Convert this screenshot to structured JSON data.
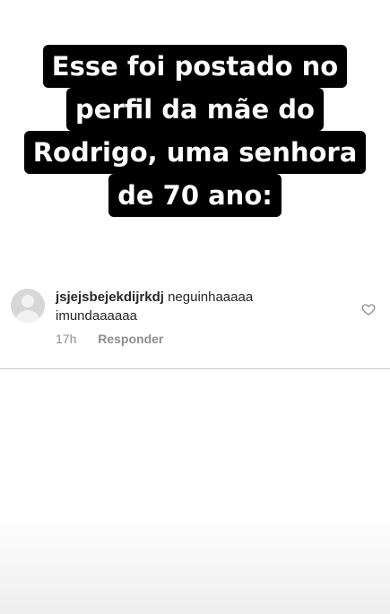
{
  "caption": {
    "lines": [
      "Esse foi postado no",
      "perfil da mãe do",
      "Rodrigo, uma senhora",
      "de 70 ano:"
    ]
  },
  "comment": {
    "username": "jsjejsbejekdijrkdj",
    "text": "neguinhaaaaa imundaaaaaa",
    "time": "17h",
    "reply_label": "Responder",
    "like_icon": "heart-icon",
    "avatar_icon": "default-avatar-icon"
  },
  "colors": {
    "caption_bg": "#000000",
    "caption_text": "#ffffff",
    "meta_text": "#8e8e8e",
    "comment_text": "#262626"
  }
}
